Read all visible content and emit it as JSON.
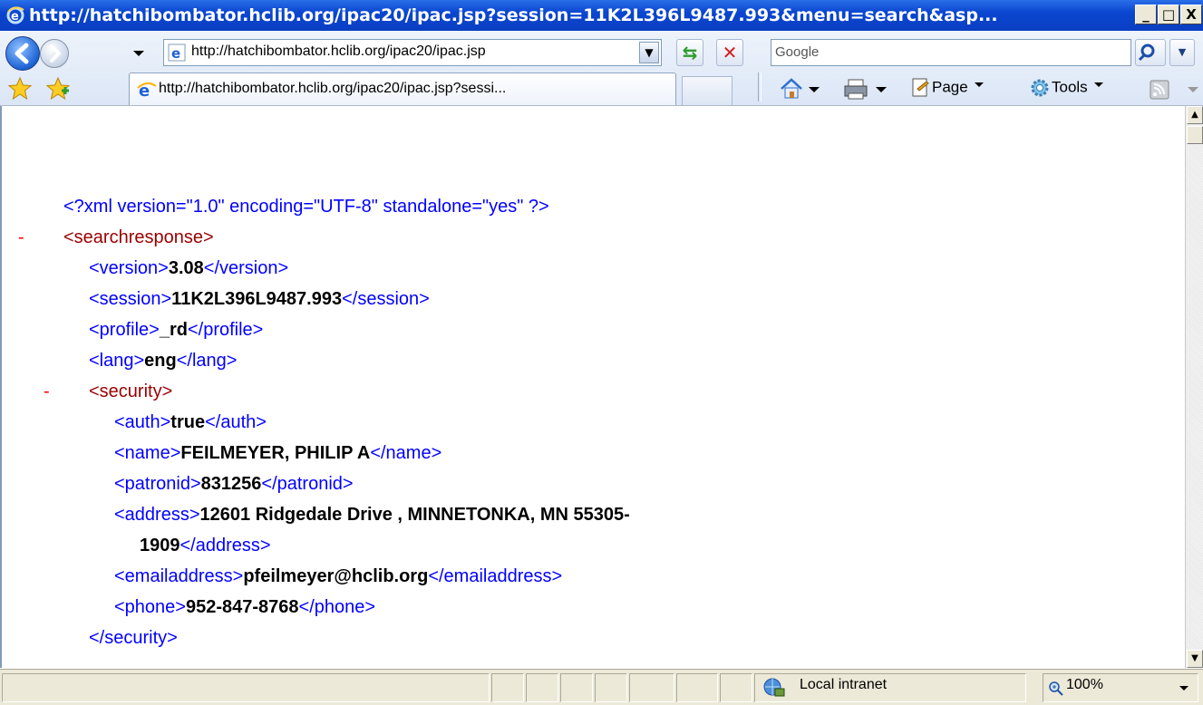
{
  "window": {
    "title": "http://hatchibombator.hclib.org/ipac20/ipac.jsp?session=11K2L396L9487.993&menu=search&asp...",
    "minimize": "_",
    "maximize": "□",
    "close": "X"
  },
  "navbar": {
    "address": "http://hatchibombator.hclib.org/ipac20/ipac.jsp",
    "search_placeholder": "Google"
  },
  "tabs": [
    {
      "label": "http://hatchibombator.hclib.org/ipac20/ipac.jsp?sessi..."
    }
  ],
  "command_bar": {
    "page_label": "Page",
    "tools_label": "Tools"
  },
  "xml": {
    "declaration": "<?xml version=\"1.0\" encoding=\"UTF-8\" standalone=\"yes\" ?>",
    "minus": "-",
    "root_open": "<searchresponse>",
    "version": {
      "open": "<version>",
      "value": "3.08",
      "close": "</version>"
    },
    "session": {
      "open": "<session>",
      "value": "11K2L396L9487.993",
      "close": "</session>"
    },
    "profile": {
      "open": "<profile>",
      "value": "_rd",
      "close": "</profile>"
    },
    "lang": {
      "open": "<lang>",
      "value": "eng",
      "close": "</lang>"
    },
    "security_open": "<security>",
    "auth": {
      "open": "<auth>",
      "value": "true",
      "close": "</auth>"
    },
    "name": {
      "open": "<name>",
      "value": "FEILMEYER, PHILIP A",
      "close": "</name>"
    },
    "patronid": {
      "open": "<patronid>",
      "value": "831256",
      "close": "</patronid>"
    },
    "address": {
      "open": "<address>",
      "value_line1": "12601 Ridgedale Drive , MINNETONKA, MN 55305-",
      "value_line2": "1909",
      "close": "</address>"
    },
    "emailaddress": {
      "open": "<emailaddress>",
      "value": "pfeilmeyer@hclib.org",
      "close": "</emailaddress>"
    },
    "phone": {
      "open": "<phone>",
      "value": "952-847-8768",
      "close": "</phone>"
    },
    "security_close": "</security>"
  },
  "statusbar": {
    "zone": "Local intranet",
    "zoom": "100%"
  },
  "colors": {
    "titlebar": "#0a46d0",
    "xml_tag_bracket": "#0000ff",
    "xml_tag_name": "#990000",
    "xml_minus": "#ff0000"
  }
}
